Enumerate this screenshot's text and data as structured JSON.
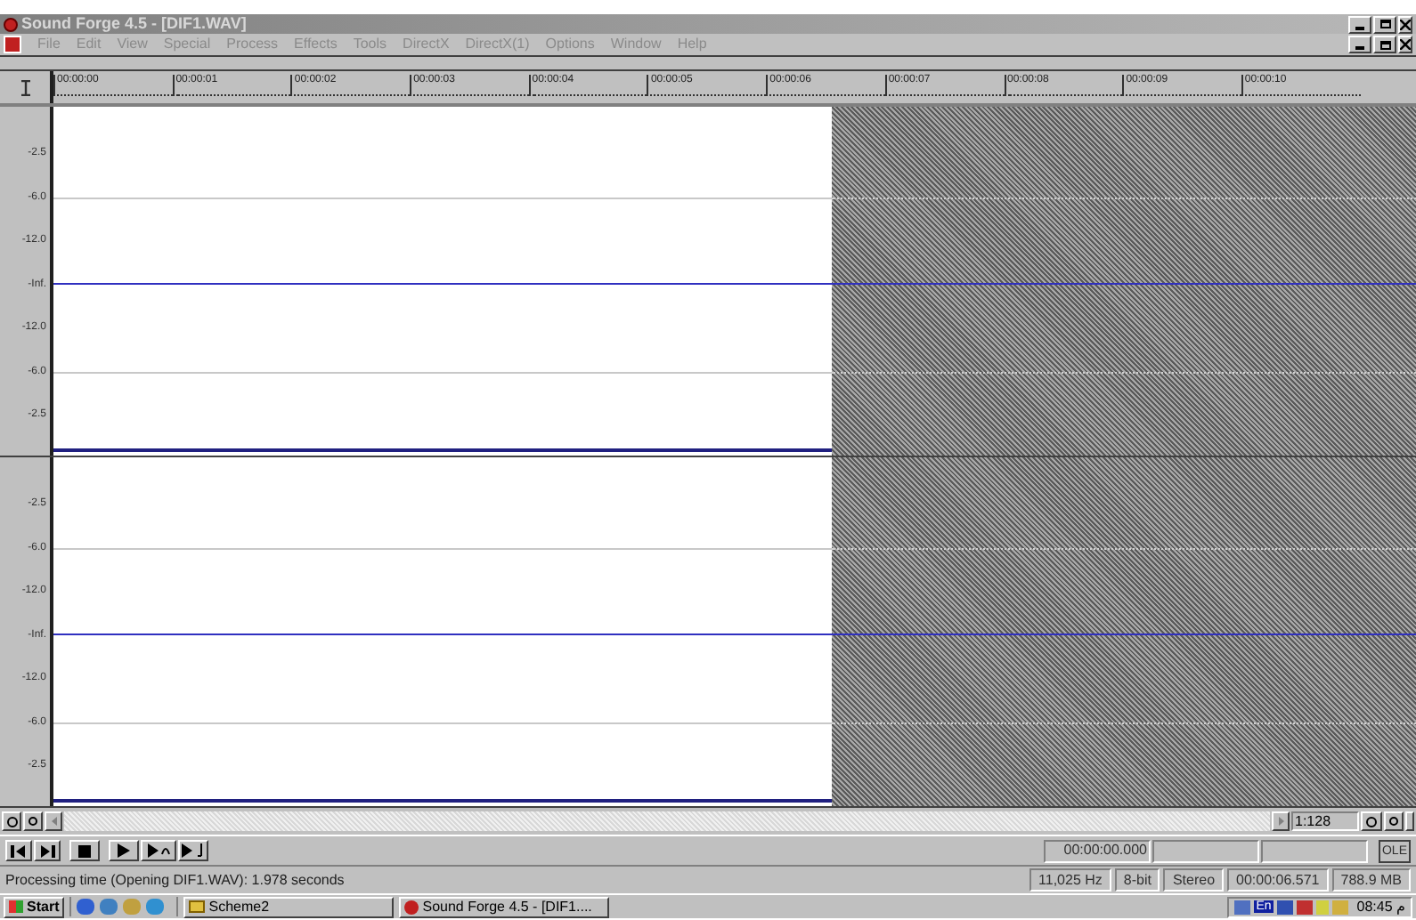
{
  "window": {
    "title": "Sound Forge 4.5 - [DIF1.WAV]"
  },
  "menu": [
    {
      "label": "File",
      "disabled": true
    },
    {
      "label": "Edit",
      "disabled": true
    },
    {
      "label": "View",
      "disabled": true
    },
    {
      "label": "Special",
      "disabled": true
    },
    {
      "label": "Process",
      "disabled": true
    },
    {
      "label": "Effects",
      "disabled": true
    },
    {
      "label": "Tools",
      "disabled": true
    },
    {
      "label": "DirectX",
      "disabled": true
    },
    {
      "label": "DirectX(1)",
      "disabled": true
    },
    {
      "label": "Options",
      "disabled": true
    },
    {
      "label": "Window",
      "disabled": true
    },
    {
      "label": "Help",
      "disabled": true
    }
  ],
  "ruler": [
    "00:00:00",
    "00:00:01",
    "00:00:02",
    "00:00:03",
    "00:00:04",
    "00:00:05",
    "00:00:06",
    "00:00:07",
    "00:00:08",
    "00:00:09",
    "00:00:10"
  ],
  "channels": [
    {
      "scale": [
        "-2.5",
        "-6.0",
        "-12.0",
        "-Inf.",
        "-12.0",
        "-6.0",
        "-2.5"
      ]
    },
    {
      "scale": [
        "-2.5",
        "-6.0",
        "-12.0",
        "-Inf.",
        "-12.0",
        "-6.0",
        "-2.5"
      ]
    }
  ],
  "zoom_ratio": "1:128",
  "transport": {
    "position": "00:00:00.000",
    "ole_button": "OLE"
  },
  "status_bar": {
    "message": "Processing time (Opening DIF1.WAV): 1.978 seconds",
    "fields": [
      "11,025 Hz",
      "8-bit",
      "Stereo",
      "00:00:06.571",
      "788.9 MB"
    ]
  },
  "taskbar": {
    "start": "Start",
    "tasks": [
      {
        "label": "Scheme2",
        "kind": "folder",
        "selected": false
      },
      {
        "label": "Sound Forge 4.5 - [DIF1....",
        "kind": "app",
        "selected": false
      }
    ],
    "language": "En",
    "clock": "08:45 م"
  }
}
